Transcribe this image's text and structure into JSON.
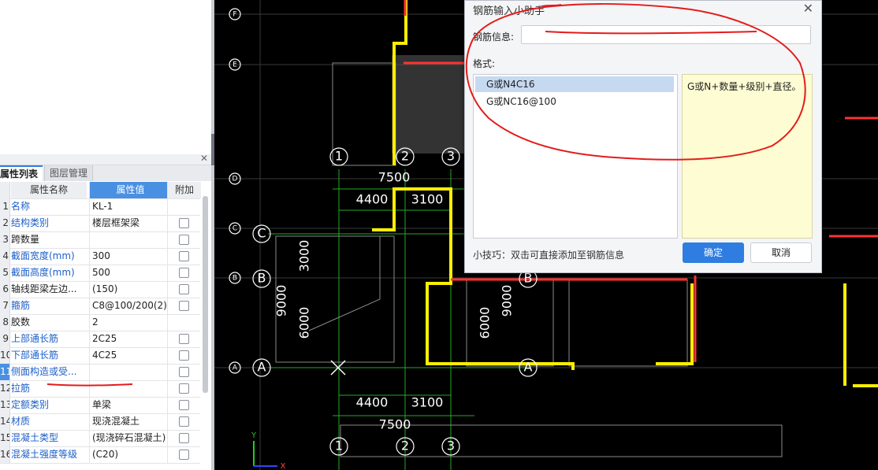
{
  "props_panel": {
    "tabs": [
      "属性列表",
      "图层管理"
    ],
    "columns": {
      "name": "属性名称",
      "value": "属性值",
      "extra": "附加"
    },
    "rows": [
      {
        "num": "1",
        "name": "名称",
        "value": "KL-1",
        "blue": true,
        "check": false
      },
      {
        "num": "2",
        "name": "结构类别",
        "value": "楼层框架梁",
        "blue": true,
        "check": true
      },
      {
        "num": "3",
        "name": "跨数量",
        "value": "",
        "blue": false,
        "check": true
      },
      {
        "num": "4",
        "name": "截面宽度(mm)",
        "value": "300",
        "blue": true,
        "check": true
      },
      {
        "num": "5",
        "name": "截面高度(mm)",
        "value": "500",
        "blue": true,
        "check": true
      },
      {
        "num": "6",
        "name": "轴线距梁左边...",
        "value": "(150)",
        "blue": false,
        "check": true
      },
      {
        "num": "7",
        "name": "箍筋",
        "value": "C8@100/200(2)",
        "blue": true,
        "check": true
      },
      {
        "num": "8",
        "name": "胶数",
        "value": "2",
        "blue": false,
        "check": false
      },
      {
        "num": "9",
        "name": "上部通长筋",
        "value": "2C25",
        "blue": true,
        "check": true
      },
      {
        "num": "10",
        "name": "下部通长筋",
        "value": "4C25",
        "blue": true,
        "check": true
      },
      {
        "num": "11",
        "name": "侧面构造或受...",
        "value": "",
        "blue": true,
        "check": true
      },
      {
        "num": "12",
        "name": "拉筋",
        "value": "",
        "blue": true,
        "check": true
      },
      {
        "num": "13",
        "name": "定额类别",
        "value": "单梁",
        "blue": true,
        "check": true
      },
      {
        "num": "14",
        "name": "材质",
        "value": "现浇混凝土",
        "blue": true,
        "check": true
      },
      {
        "num": "15",
        "name": "混凝土类型",
        "value": "(现浇碎石混凝土)",
        "blue": true,
        "check": true
      },
      {
        "num": "16",
        "name": "混凝土强度等级",
        "value": "(C20)",
        "blue": true,
        "check": true
      }
    ],
    "edit_button": "···"
  },
  "dialog": {
    "title": "钢筋输入小助手",
    "info_label": "钢筋信息:",
    "info_value": "",
    "format_label": "格式:",
    "formats": [
      "G或N4C16",
      "G或NC16@100"
    ],
    "description": "G或N+数量+级别+直径。",
    "tip": "小技巧：双击可直接添加至钢筋信息",
    "ok": "确定",
    "cancel": "取消",
    "close": "✕"
  },
  "cad": {
    "axis_letters": [
      "C",
      "B",
      "A"
    ],
    "axis_numbers": [
      "1",
      "2",
      "3"
    ],
    "left_bubbles": [
      "F",
      "E",
      "D",
      "C",
      "B",
      "A"
    ],
    "dims_top": [
      "7500",
      "4400",
      "3100"
    ],
    "dims_bottom": [
      "4400",
      "3100",
      "7500"
    ],
    "dims_vertical": [
      "3000",
      "9000",
      "6000",
      "6000",
      "9000"
    ],
    "coord_axes": [
      "Y",
      "X"
    ]
  },
  "colors": {
    "annotation": "#e41b1b",
    "wall": "#ffee00",
    "cad_bg": "#000000",
    "accent": "#2f7de1"
  }
}
